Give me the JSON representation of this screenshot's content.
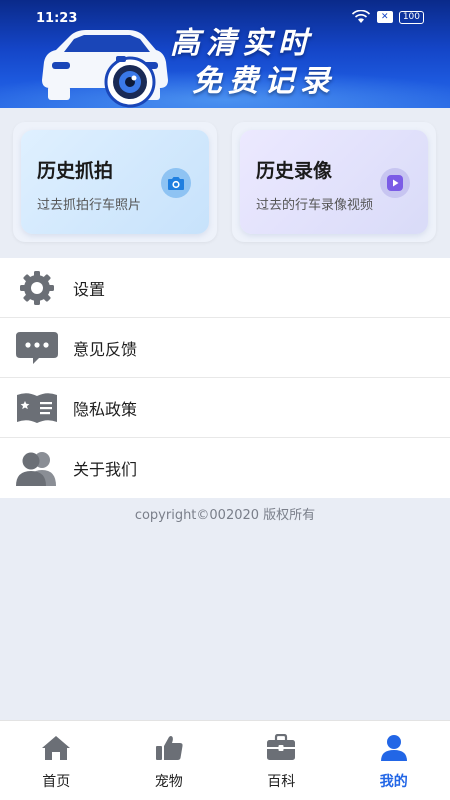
{
  "status_bar": {
    "time": "11:23",
    "sim_label": "✕",
    "battery": "100"
  },
  "banner": {
    "line1": "高清实时",
    "line2": "免费记录"
  },
  "cards": [
    {
      "title": "历史抓拍",
      "subtitle": "过去抓拍行车照片",
      "icon": "camera-icon"
    },
    {
      "title": "历史录像",
      "subtitle": "过去的行车录像视频",
      "icon": "video-play-icon"
    }
  ],
  "menu": [
    {
      "label": "设置",
      "icon": "gear-icon"
    },
    {
      "label": "意见反馈",
      "icon": "chat-bubble-icon"
    },
    {
      "label": "隐私政策",
      "icon": "privacy-book-icon"
    },
    {
      "label": "关于我们",
      "icon": "users-icon"
    }
  ],
  "copyright": "copyright©002020 版权所有",
  "bottom_nav": [
    {
      "label": "首页",
      "icon": "home-icon"
    },
    {
      "label": "宠物",
      "icon": "thumbs-up-icon"
    },
    {
      "label": "百科",
      "icon": "briefcase-icon"
    },
    {
      "label": "我的",
      "icon": "user-icon",
      "active": true
    }
  ],
  "colors": {
    "banner_blue": "#1445c7",
    "active_blue": "#2266e6",
    "icon_gray": "#6b6f76"
  }
}
